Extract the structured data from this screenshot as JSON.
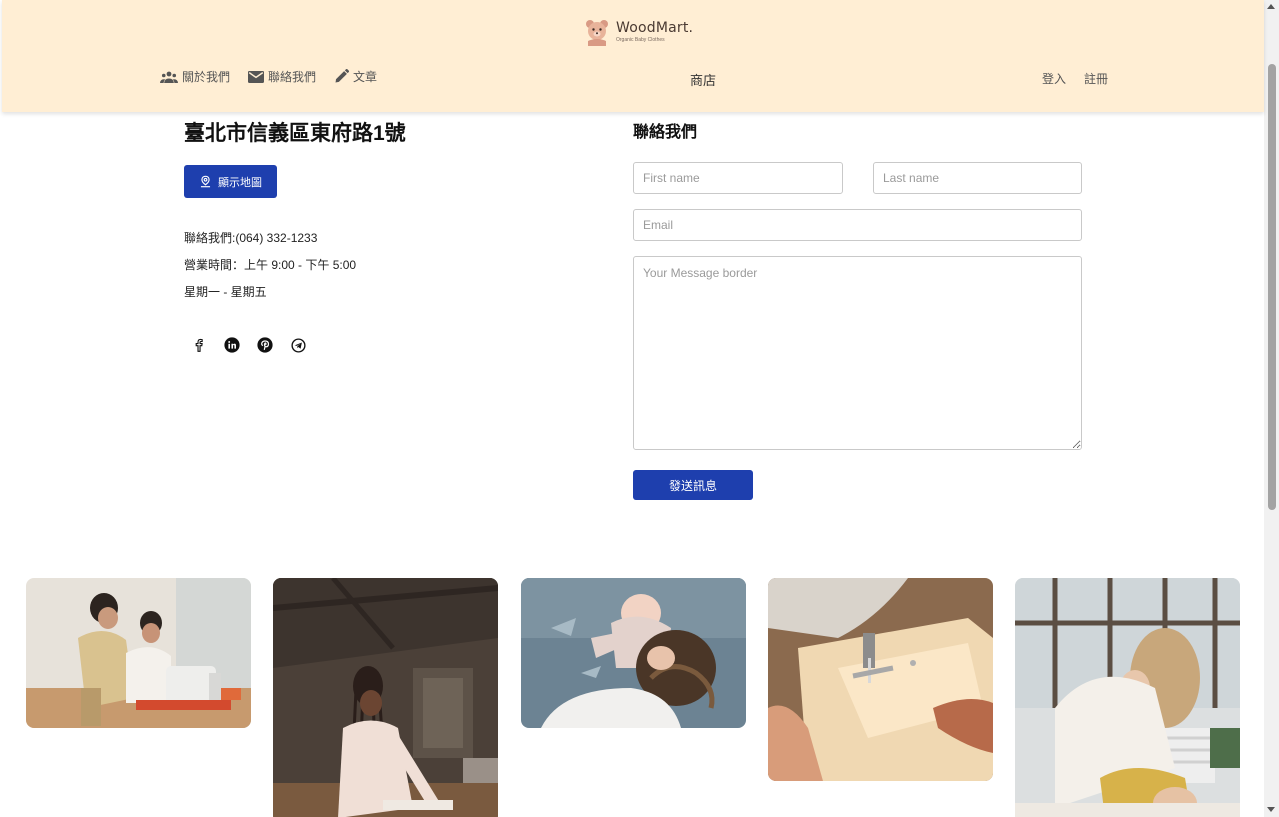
{
  "header": {
    "brand": "WoodMart.",
    "brand_sub": "Organic Baby Clothes",
    "nav_left": [
      {
        "label": "關於我們",
        "icon": "people-icon"
      },
      {
        "label": "聯絡我們",
        "icon": "mail-icon"
      },
      {
        "label": "文章",
        "icon": "pencil-icon"
      }
    ],
    "nav_center": "商店",
    "nav_right": [
      "登入",
      "註冊"
    ]
  },
  "location": {
    "address": "臺北市信義區東府路1號",
    "map_button": "顯示地圖",
    "phone": "聯絡我們:(064) 332-1233",
    "hours": "營業時間：上午 9:00 - 下午 5:00",
    "days": "星期一 - 星期五",
    "social": [
      "facebook-icon",
      "linkedin-icon",
      "pinterest-icon",
      "telegram-icon"
    ]
  },
  "contact_form": {
    "title": "聯絡我們",
    "first_name_placeholder": "First name",
    "last_name_placeholder": "Last name",
    "email_placeholder": "Email",
    "message_placeholder": "Your Message border",
    "submit_label": "發送訊息"
  },
  "colors": {
    "header_bg": "#ffeed4",
    "primary": "#1e3fae"
  },
  "gallery": [
    "sewing-workshop-photo",
    "tailor-woman-photo",
    "mother-and-baby-photo",
    "sewing-machine-closeup-photo",
    "mother-dressing-baby-photo"
  ]
}
